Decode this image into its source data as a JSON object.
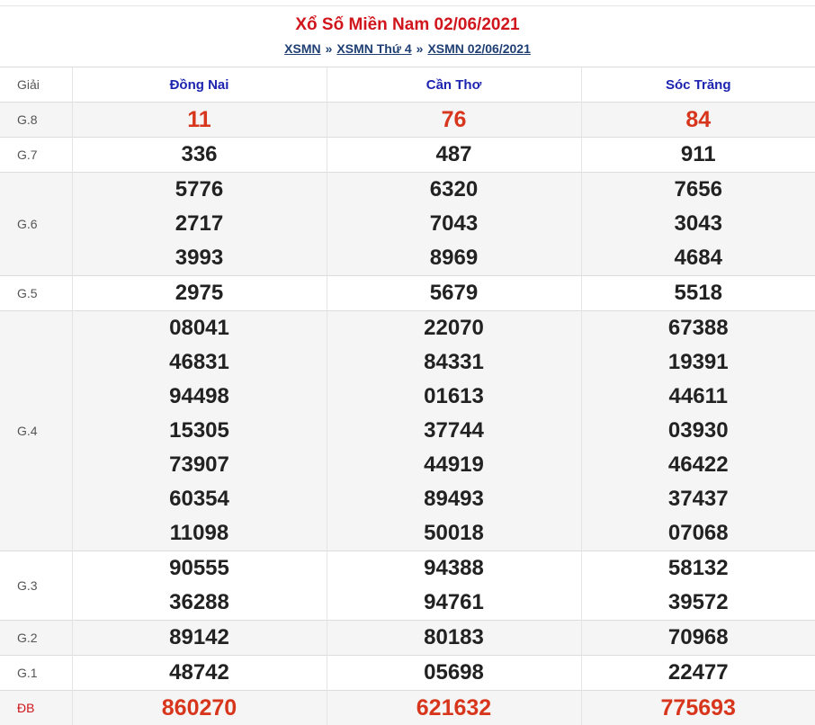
{
  "header": {
    "title": "Xổ Số Miền Nam 02/06/2021",
    "breadcrumb": {
      "item1": "XSMN",
      "sep1": "»",
      "item2": "XSMN Thứ 4",
      "sep2": "»",
      "item3": "XSMN 02/06/2021"
    }
  },
  "table": {
    "col_prize": "Giải",
    "provinces": [
      "Đồng Nai",
      "Cần Thơ",
      "Sóc Trăng"
    ],
    "rows": [
      {
        "label": "G.8",
        "values": [
          [
            "11"
          ],
          [
            "76"
          ],
          [
            "84"
          ]
        ]
      },
      {
        "label": "G.7",
        "values": [
          [
            "336"
          ],
          [
            "487"
          ],
          [
            "911"
          ]
        ]
      },
      {
        "label": "G.6",
        "values": [
          [
            "5776",
            "2717",
            "3993"
          ],
          [
            "6320",
            "7043",
            "8969"
          ],
          [
            "7656",
            "3043",
            "4684"
          ]
        ]
      },
      {
        "label": "G.5",
        "values": [
          [
            "2975"
          ],
          [
            "5679"
          ],
          [
            "5518"
          ]
        ]
      },
      {
        "label": "G.4",
        "values": [
          [
            "08041",
            "46831",
            "94498",
            "15305",
            "73907",
            "60354",
            "11098"
          ],
          [
            "22070",
            "84331",
            "01613",
            "37744",
            "44919",
            "89493",
            "50018"
          ],
          [
            "67388",
            "19391",
            "44611",
            "03930",
            "46422",
            "37437",
            "07068"
          ]
        ]
      },
      {
        "label": "G.3",
        "values": [
          [
            "90555",
            "36288"
          ],
          [
            "94388",
            "94761"
          ],
          [
            "58132",
            "39572"
          ]
        ]
      },
      {
        "label": "G.2",
        "values": [
          [
            "89142"
          ],
          [
            "80183"
          ],
          [
            "70968"
          ]
        ]
      },
      {
        "label": "G.1",
        "values": [
          [
            "48742"
          ],
          [
            "05698"
          ],
          [
            "22477"
          ]
        ]
      },
      {
        "label": "ĐB",
        "values": [
          [
            "860270"
          ],
          [
            "621632"
          ],
          [
            "775693"
          ]
        ]
      }
    ]
  },
  "colors": {
    "title_red": "#d0161c",
    "number_red": "#d8361c",
    "province_blue": "#1c24b0",
    "link_blue": "#1f3f74",
    "row_alt_bg": "#f5f5f5"
  }
}
